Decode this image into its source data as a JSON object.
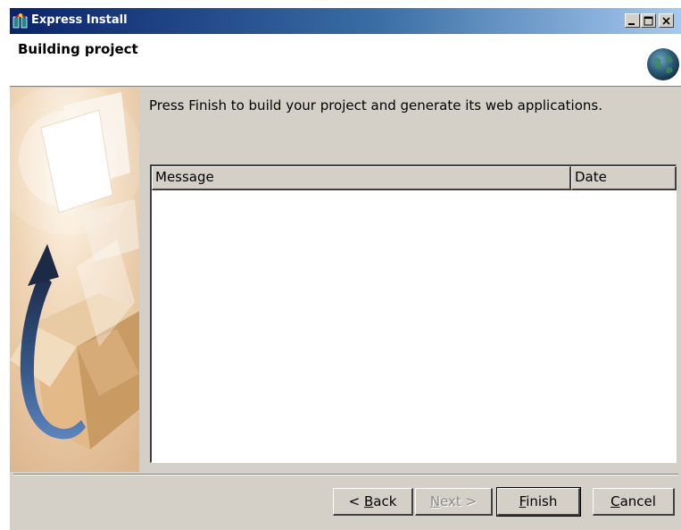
{
  "window": {
    "title": "Express Install",
    "controls": {
      "minimize": "_",
      "maximize": "□",
      "close": "×"
    }
  },
  "header": {
    "title": "Building project",
    "icon": "globe-icon"
  },
  "content": {
    "instruction": "Press Finish to build your project and generate its web applications."
  },
  "table": {
    "columns": [
      "Message",
      "Date"
    ],
    "rows": []
  },
  "buttons": {
    "back": {
      "pre": "< ",
      "mnemonic": "B",
      "post": "ack"
    },
    "next": {
      "pre": "",
      "mnemonic": "N",
      "post": "ext >",
      "disabled": true
    },
    "finish": {
      "pre": "",
      "mnemonic": "F",
      "post": "inish"
    },
    "cancel": {
      "pre": "",
      "mnemonic": "C",
      "post": "ancel"
    }
  },
  "colors": {
    "titlebar_start": "#0a246a",
    "titlebar_end": "#a6caf0",
    "face": "#d4d0c8"
  }
}
